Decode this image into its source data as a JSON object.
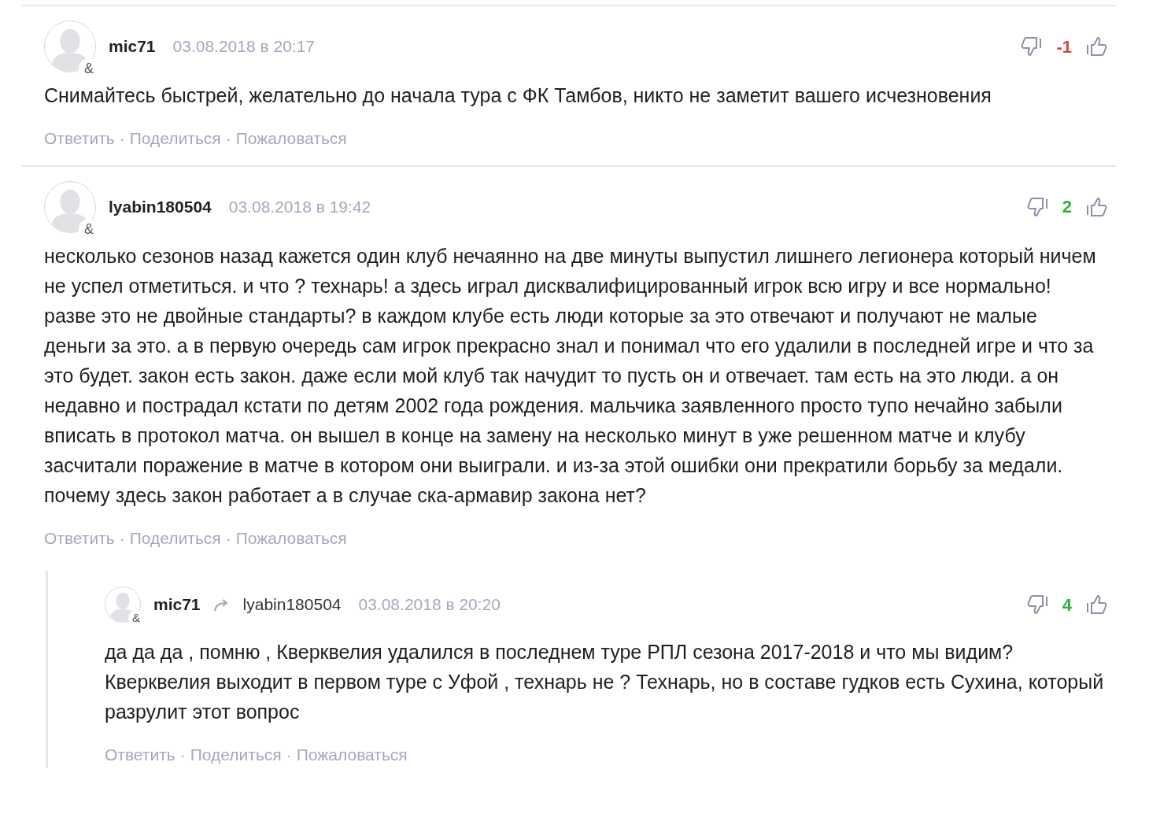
{
  "comments": [
    {
      "author": "mic71",
      "badge": "&",
      "date": "03.08.2018 в 20:17",
      "score": "-1",
      "color": "#e0413f",
      "text": "Снимайтесь быстрей, желательно до начала тура с ФК Тамбов, никто не заметит вашего исчезновения",
      "actions": [
        "Ответить",
        "Поделиться",
        "Пожаловаться"
      ],
      "separator": "·"
    },
    {
      "author": "lyabin180504",
      "badge": "&",
      "date": "03.08.2018 в 19:42",
      "score": "2",
      "color": "#2bb33e",
      "text": "несколько сезонов назад кажется один клуб нечаянно на две минуты выпустил лишнего легионера который ничем не успел отметиться. и что ? технарь! а здесь играл дисквалифицированный игрок всю игру и все нормально! разве это не двойные стандарты? в каждом клубе есть люди которые за это отвечают и получают не малые деньги за это. а в первую очередь сам игрок прекрасно знал и понимал что его удалили в последней игре и что за это будет. закон есть закон. даже если мой клуб так начудит то пусть он и отвечает. там есть на это люди. а он недавно и пострадал кстати по детям 2002 года рождения. мальчика заявленного просто тупо нечайно забыли вписать в протокол матча. он вышел в конце на замену на несколько минут в уже решенном матче и клубу засчитали поражение в матче в котором они выиграли. и из-за этой ошибки они прекратили борьбу за медали. почему здесь закон работает а в случае ска-армавир закона нет?",
      "actions": [
        "Ответить",
        "Поделиться",
        "Пожаловаться"
      ],
      "separator": "·",
      "children": [
        {
          "author": "mic71",
          "badge": "&",
          "reply_to": "lyabin180504",
          "date": "03.08.2018 в 20:20",
          "score": "4",
          "color": "#2bb33e",
          "text": "да да да , помню , Кверквелия удалился в последнем туре РПЛ сезона 2017-2018 и что мы видим? Кверквелия выходит в первом туре с Уфой , технарь не ? Технарь, но в составе гудков есть Сухина, который разрулит этот вопрос",
          "actions": [
            "Ответить",
            "Поделиться",
            "Пожаловаться"
          ],
          "separator": "·"
        }
      ]
    }
  ]
}
